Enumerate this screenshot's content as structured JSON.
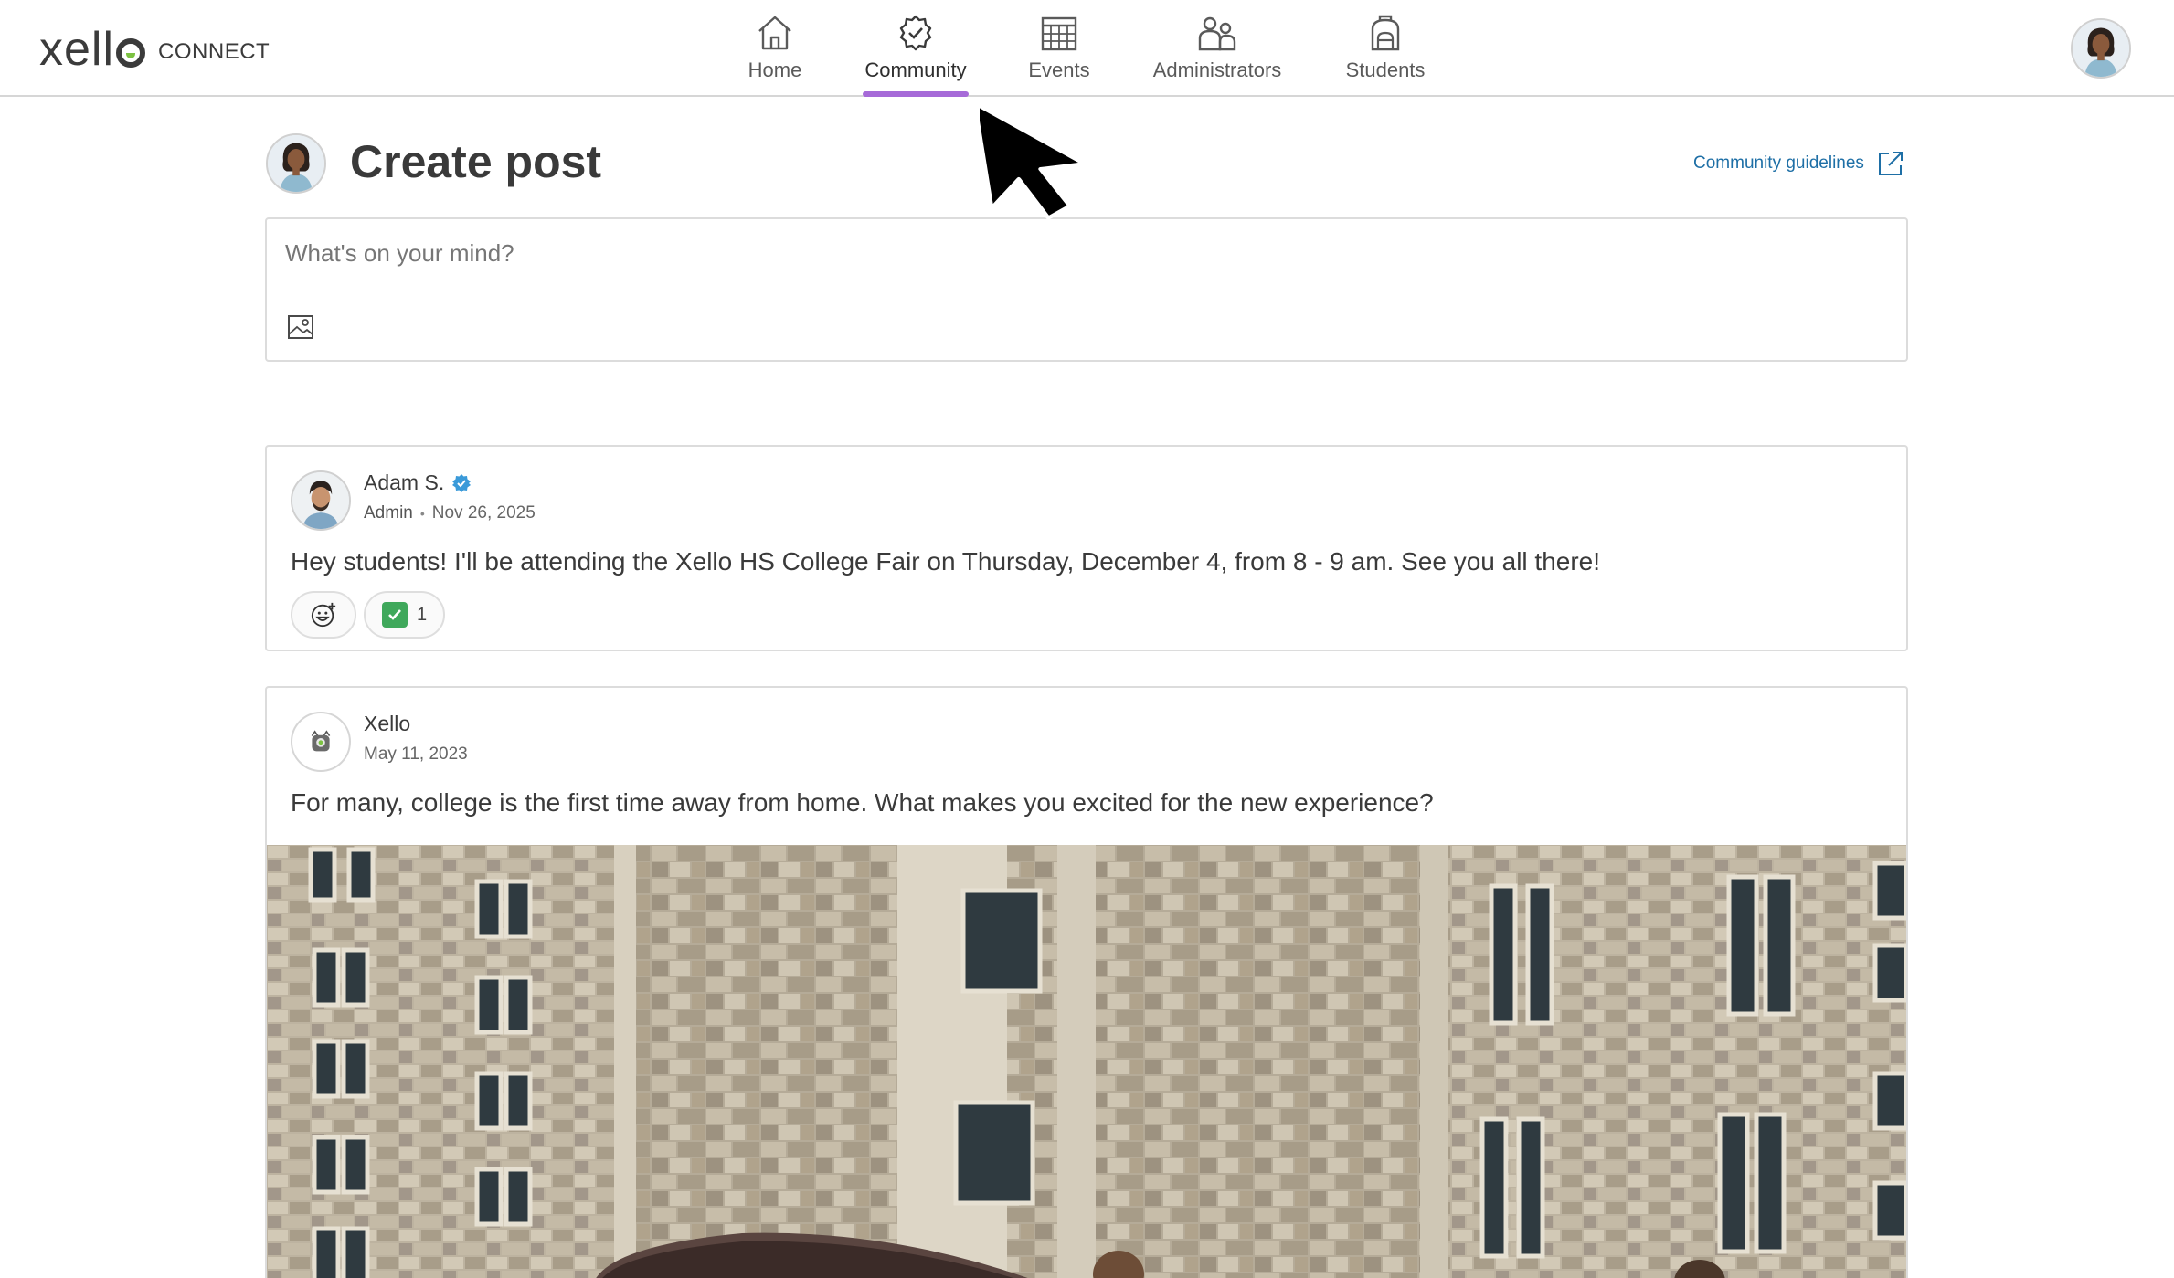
{
  "header": {
    "logo_word": "xell",
    "logo_suffix": "CONNECT",
    "nav": [
      {
        "id": "home",
        "label": "Home",
        "icon": "home-icon",
        "active": false
      },
      {
        "id": "community",
        "label": "Community",
        "icon": "badge-check-icon",
        "active": true
      },
      {
        "id": "events",
        "label": "Events",
        "icon": "calendar-icon",
        "active": false
      },
      {
        "id": "administrators",
        "label": "Administrators",
        "icon": "people-icon",
        "active": false
      },
      {
        "id": "students",
        "label": "Students",
        "icon": "backpack-icon",
        "active": false
      }
    ],
    "accent_color": "#a66ad8"
  },
  "create_post": {
    "title": "Create post",
    "guidelines_link": "Community guidelines",
    "placeholder": "What's on your mind?"
  },
  "posts": [
    {
      "author": "Adam S.",
      "verified": true,
      "role": "Admin",
      "date": "Nov 26, 2025",
      "body": "Hey students! I'll be attending the Xello HS College Fair on Thursday, December 4, from 8 - 9 am. See you all there!",
      "reactions": [
        {
          "emoji": "check-mark-emoji",
          "count": "1"
        }
      ]
    },
    {
      "author": "Xello",
      "date": "May 11, 2023",
      "body": "For many, college is the first time away from home. What makes you excited for the new experience?",
      "image": "college-campus-stone-building-photo"
    }
  ],
  "colors": {
    "link": "#1e6fa6",
    "verified_badge": "#3a9ad9",
    "reaction_check": "#3fa85b"
  }
}
